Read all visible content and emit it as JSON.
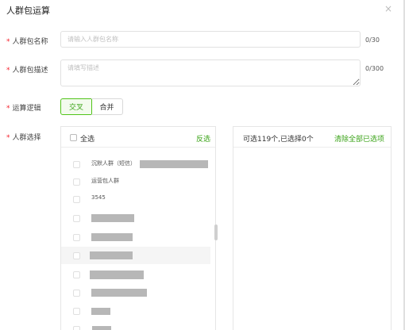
{
  "dialog": {
    "title": "人群包运算",
    "close_icon": "×"
  },
  "form": {
    "name": {
      "required_mark": "*",
      "label": "人群包名称",
      "placeholder": "请输入人群包名称",
      "value": "",
      "counter": "0/30"
    },
    "description": {
      "required_mark": "*",
      "label": "人群包描述",
      "placeholder": "请填写描述",
      "value": "",
      "counter": "0/300"
    },
    "logic": {
      "required_mark": "*",
      "label": "运算逻辑",
      "options": [
        "交叉",
        "合并"
      ],
      "selected": "交叉"
    },
    "selection": {
      "required_mark": "*",
      "label": "人群选择"
    }
  },
  "left_panel": {
    "select_all": "全选",
    "invert": "反选",
    "items": [
      {
        "label": "沉默人群（短信）"
      },
      {
        "label": "运营包人群"
      },
      {
        "label": "3545"
      },
      {
        "label": ""
      },
      {
        "label": ""
      },
      {
        "label": ""
      },
      {
        "label": ""
      },
      {
        "label": ""
      },
      {
        "label": ""
      },
      {
        "label": ""
      }
    ]
  },
  "right_panel": {
    "summary": "可选119个,已选择0个",
    "clear_all": "清除全部已选项"
  },
  "colors": {
    "accent": "#52c41a",
    "accent_text": "#3aa317",
    "required": "#f5222d",
    "redaction": "#b7b7b7"
  }
}
